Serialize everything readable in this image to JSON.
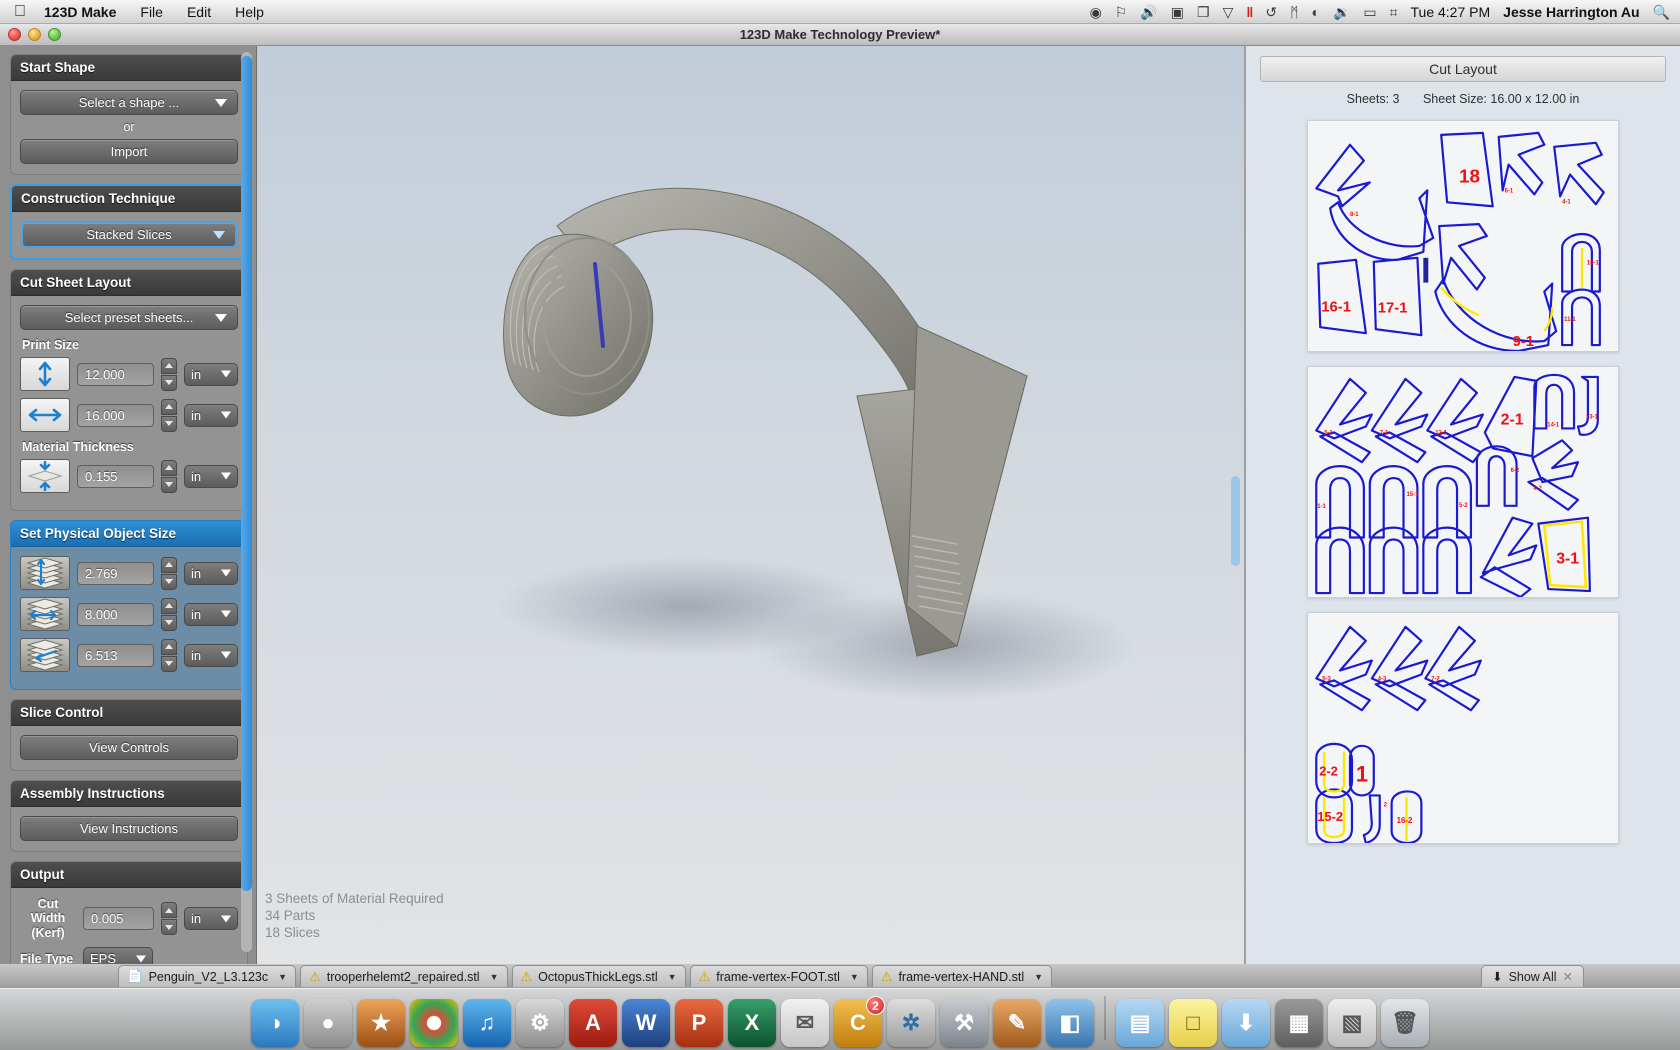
{
  "menubar": {
    "apple_icon": "apple-logo",
    "app_name": "123D Make",
    "items": [
      {
        "label": "File"
      },
      {
        "label": "Edit"
      },
      {
        "label": "Help"
      }
    ],
    "status_icons": [
      {
        "name": "dropbox-icon",
        "glyph": "⬢"
      },
      {
        "name": "antivirus-icon",
        "glyph": "⛔"
      },
      {
        "name": "volume-icon",
        "glyph": "🔊"
      },
      {
        "name": "display-icon",
        "glyph": "▣"
      },
      {
        "name": "clipboard-icon",
        "glyph": "❐"
      },
      {
        "name": "chevron-down-icon",
        "glyph": "▽"
      },
      {
        "name": "pause-icon",
        "glyph": "‖"
      },
      {
        "name": "timemachine-icon",
        "glyph": "↺"
      },
      {
        "name": "bluetooth-icon",
        "glyph": "ᛗ"
      },
      {
        "name": "wifi-icon",
        "glyph": "◠"
      },
      {
        "name": "speaker-icon",
        "glyph": "🔉"
      },
      {
        "name": "battery-icon",
        "glyph": "▭"
      },
      {
        "name": "keyboard-input-icon",
        "glyph": "⌗"
      }
    ],
    "clock": "Tue 4:27 PM",
    "user": "Jesse Harrington Au",
    "search_icon": "search-icon"
  },
  "window": {
    "title": "123D Make Technology Preview*",
    "traffic_lights": [
      "close-button",
      "minimize-button",
      "zoom-button"
    ]
  },
  "sidebar": {
    "groups": [
      {
        "id": "start-shape",
        "title": "Start Shape",
        "shape_select": {
          "label": "Select a shape ...",
          "icon": "chevron-down-icon"
        },
        "or_label": "or",
        "import_label": "Import"
      },
      {
        "id": "construction-technique",
        "title": "Construction Technique",
        "technique_select": {
          "label": "Stacked Slices",
          "icon": "chevron-down-icon"
        }
      },
      {
        "id": "cut-sheet-layout",
        "title": "Cut Sheet Layout",
        "preset_select": {
          "label": "Select preset sheets...",
          "icon": "chevron-down-icon"
        },
        "print_size_label": "Print Size",
        "height_field": {
          "icon": "vertical-arrow-icon",
          "value": "12.000",
          "unit": "in"
        },
        "width_field": {
          "icon": "horizontal-arrow-icon",
          "value": "16.000",
          "unit": "in"
        },
        "material_thickness_label": "Material Thickness",
        "thickness_field": {
          "icon": "thickness-arrow-icon",
          "value": "0.155",
          "unit": "in"
        }
      },
      {
        "id": "set-physical-object-size",
        "title": "Set Physical Object Size",
        "height_field": {
          "icon": "stack-height-icon",
          "value": "2.769",
          "unit": "in"
        },
        "width_field": {
          "icon": "stack-width-icon",
          "value": "8.000",
          "unit": "in"
        },
        "depth_field": {
          "icon": "stack-depth-icon",
          "value": "6.513",
          "unit": "in"
        }
      },
      {
        "id": "slice-control",
        "title": "Slice Control",
        "button_label": "View Controls"
      },
      {
        "id": "assembly-instructions",
        "title": "Assembly Instructions",
        "button_label": "View Instructions"
      },
      {
        "id": "output",
        "title": "Output",
        "kerf_label_line1": "Cut Width",
        "kerf_label_line2": "(Kerf)",
        "kerf_field": {
          "value": "0.005",
          "unit": "in"
        },
        "filetype_label": "File Type",
        "filetype_value": "EPS"
      }
    ]
  },
  "viewport": {
    "status_lines": [
      "3 Sheets of Material Required",
      "34 Parts",
      "18 Slices"
    ]
  },
  "cut_layout": {
    "header": "Cut Layout",
    "sheets_label": "Sheets: 3",
    "sheet_size_label": "Sheet Size: 16.00 x 12.00 in",
    "part_colors": {
      "outline": "#1a1ad0",
      "label": "#ee1111",
      "highlight": "#ffe800"
    },
    "sheets": [
      {
        "index": 1,
        "labels": [
          "8-1",
          "18",
          "6-1",
          "4-1",
          "16-1",
          "17-1",
          "9-1",
          "10-1",
          "11-1"
        ]
      },
      {
        "index": 2,
        "labels": [
          "5-1",
          "7-1",
          "12-1",
          "2-1",
          "14-1",
          "13-1",
          "6-2",
          "4-2",
          "3-1",
          "1-1",
          "15-1",
          "5-2"
        ]
      },
      {
        "index": 3,
        "labels": [
          "5-3",
          "4-3",
          "7-2",
          "2-2",
          "1",
          "15-2",
          "16-2"
        ]
      }
    ]
  },
  "taskbar": {
    "tabs": [
      {
        "label": "Penguin_V2_L3.123c",
        "icon": "document-icon",
        "caret": "chevron-down-icon"
      },
      {
        "label": "trooperhelemt2_repaired.stl",
        "icon": "warning-icon",
        "caret": "chevron-down-icon"
      },
      {
        "label": "OctopusThickLegs.stl",
        "icon": "warning-icon",
        "caret": "chevron-down-icon"
      },
      {
        "label": "frame-vertex-FOOT.stl",
        "icon": "warning-icon",
        "caret": "chevron-down-icon"
      },
      {
        "label": "frame-vertex-HAND.stl",
        "icon": "warning-icon",
        "caret": "chevron-down-icon"
      }
    ],
    "show_all": {
      "label": "Show All",
      "icon": "download-arrow-icon",
      "close_icon": "close-icon"
    }
  },
  "dock": {
    "items": [
      {
        "name": "finder-icon",
        "glyph": "◑",
        "color": "#3d8fd6"
      },
      {
        "name": "launchpad-icon",
        "glyph": "🚀",
        "color": "#7e7e86"
      },
      {
        "name": "imovie-icon",
        "glyph": "★",
        "color": "#c86a2a"
      },
      {
        "name": "chrome-icon",
        "glyph": "◉",
        "color": "#dd4b39"
      },
      {
        "name": "itunes-icon",
        "glyph": "♫",
        "color": "#2a7fd0"
      },
      {
        "name": "system-preferences-icon",
        "glyph": "⚙",
        "color": "#8f9095"
      },
      {
        "name": "autocad-icon",
        "glyph": "A",
        "color": "#cc2222"
      },
      {
        "name": "word-icon",
        "glyph": "W",
        "color": "#2b579a"
      },
      {
        "name": "powerpoint-icon",
        "glyph": "P",
        "color": "#d24726"
      },
      {
        "name": "excel-icon",
        "glyph": "X",
        "color": "#217346"
      },
      {
        "name": "mail-icon",
        "glyph": "✉",
        "color": "#d8d8d8"
      },
      {
        "name": "chrome-canary-icon",
        "glyph": "C",
        "color": "#e8a317",
        "badge": "2"
      },
      {
        "name": "safari-icon",
        "glyph": "●",
        "color": "#1e9fd8"
      },
      {
        "name": "xcode-icon",
        "glyph": "⚒",
        "color": "#9aa0a6"
      },
      {
        "name": "sketchbook-icon",
        "glyph": "✎",
        "color": "#b56a2a"
      },
      {
        "name": "123d-make-icon",
        "glyph": "◧",
        "color": "#5b9bd5"
      },
      {
        "name": "documents-folder-icon",
        "glyph": "▤",
        "color": "#79b3dd"
      },
      {
        "name": "notes-icon",
        "glyph": "□",
        "color": "#f2e06a"
      },
      {
        "name": "downloads-folder-icon",
        "glyph": "⬇",
        "color": "#79b3dd"
      },
      {
        "name": "screenshots-folder-icon",
        "glyph": "▦",
        "color": "#6a6a6a"
      },
      {
        "name": "desktop-folder-icon",
        "glyph": "▧",
        "color": "#cfcfcf"
      },
      {
        "name": "trash-icon",
        "glyph": "🗑",
        "color": "#c9cdd1"
      }
    ]
  }
}
